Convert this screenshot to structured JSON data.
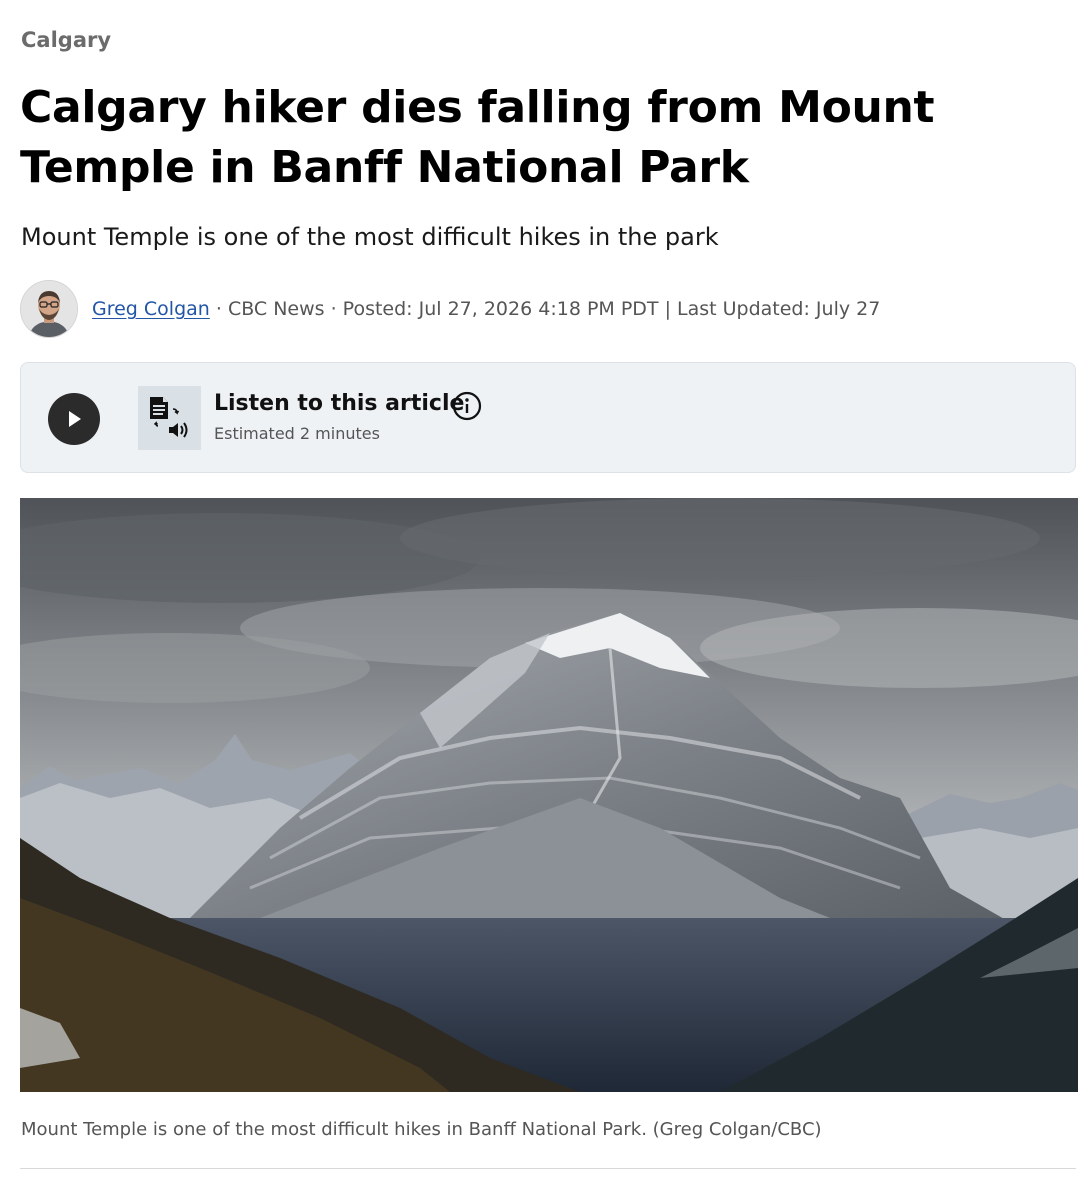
{
  "category": "Calgary",
  "headline": "Calgary hiker dies falling from Mount Temple in Banff National Park",
  "deck": "Mount Temple is one of the most difficult hikes in the park",
  "byline": {
    "author": "Greg Colgan",
    "rest": " · CBC News · Posted: Jul 27, 2026 4:18 PM PDT | Last Updated: July 27"
  },
  "listen": {
    "title": "Listen to this article",
    "subtitle": "Estimated 2 minutes",
    "icons": [
      "play-icon",
      "text-to-speech-icon",
      "info-icon"
    ]
  },
  "photo": {
    "caption": "Mount Temple is one of the most difficult hikes in Banff National Park. (Greg Colgan/CBC)"
  },
  "colors": {
    "link": "#2255a6",
    "listen_bg": "#eef2f5",
    "play_button": "#2b2b2b"
  }
}
